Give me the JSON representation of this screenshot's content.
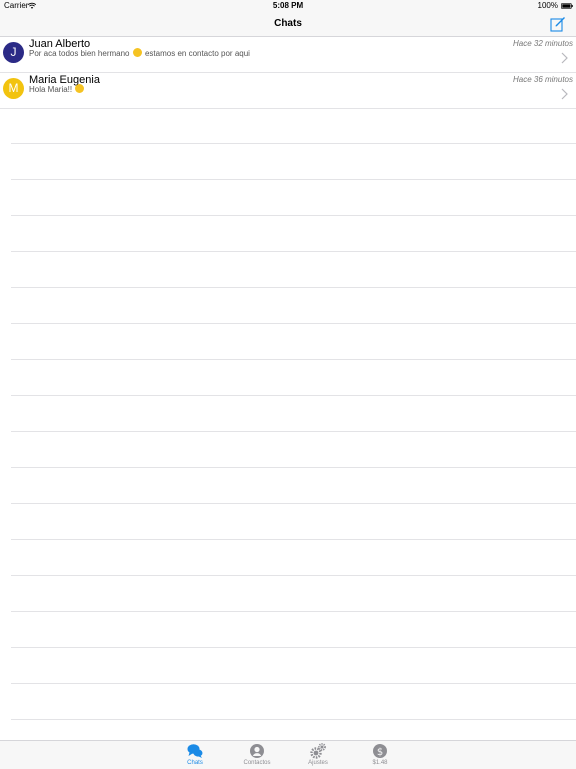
{
  "status_bar": {
    "carrier": "Carrier",
    "time": "5:08 PM",
    "battery": "100%"
  },
  "nav": {
    "title": "Chats"
  },
  "chats": [
    {
      "initial": "J",
      "name": "Juan Alberto",
      "preview_before": "Por aca todos bien hermano",
      "preview_after": "estamos en contacto por aqui",
      "time": "Hace 32 minutos",
      "avatar_color": "#2b2a86"
    },
    {
      "initial": "M",
      "name": "Maria Eugenia",
      "preview_before": "Hola Maria!!",
      "preview_after": "",
      "time": "Hace 36 minutos",
      "avatar_color": "#f2c30f"
    }
  ],
  "tabs": [
    {
      "label": "Chats",
      "icon": "chat-bubbles-icon"
    },
    {
      "label": "Contactos",
      "icon": "contact-icon"
    },
    {
      "label": "Ajustes",
      "icon": "gears-icon"
    },
    {
      "label": "$1.48",
      "icon": "dollar-icon"
    }
  ],
  "colors": {
    "accent": "#1a8ae6",
    "tab_inactive": "#8e8e93"
  }
}
